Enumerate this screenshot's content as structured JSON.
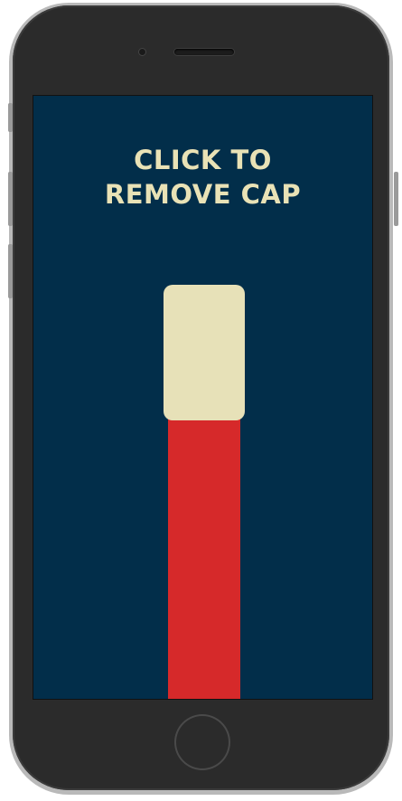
{
  "screen": {
    "title_line1": "CLICK TO",
    "title_line2": "REMOVE CAP"
  },
  "colors": {
    "background": "#022e4a",
    "text": "#e9e2b6",
    "cap": "#e7e1b8",
    "pen_body": "#d6292a",
    "device": "#2b2b2b"
  },
  "icons": {
    "home": "home-button"
  }
}
